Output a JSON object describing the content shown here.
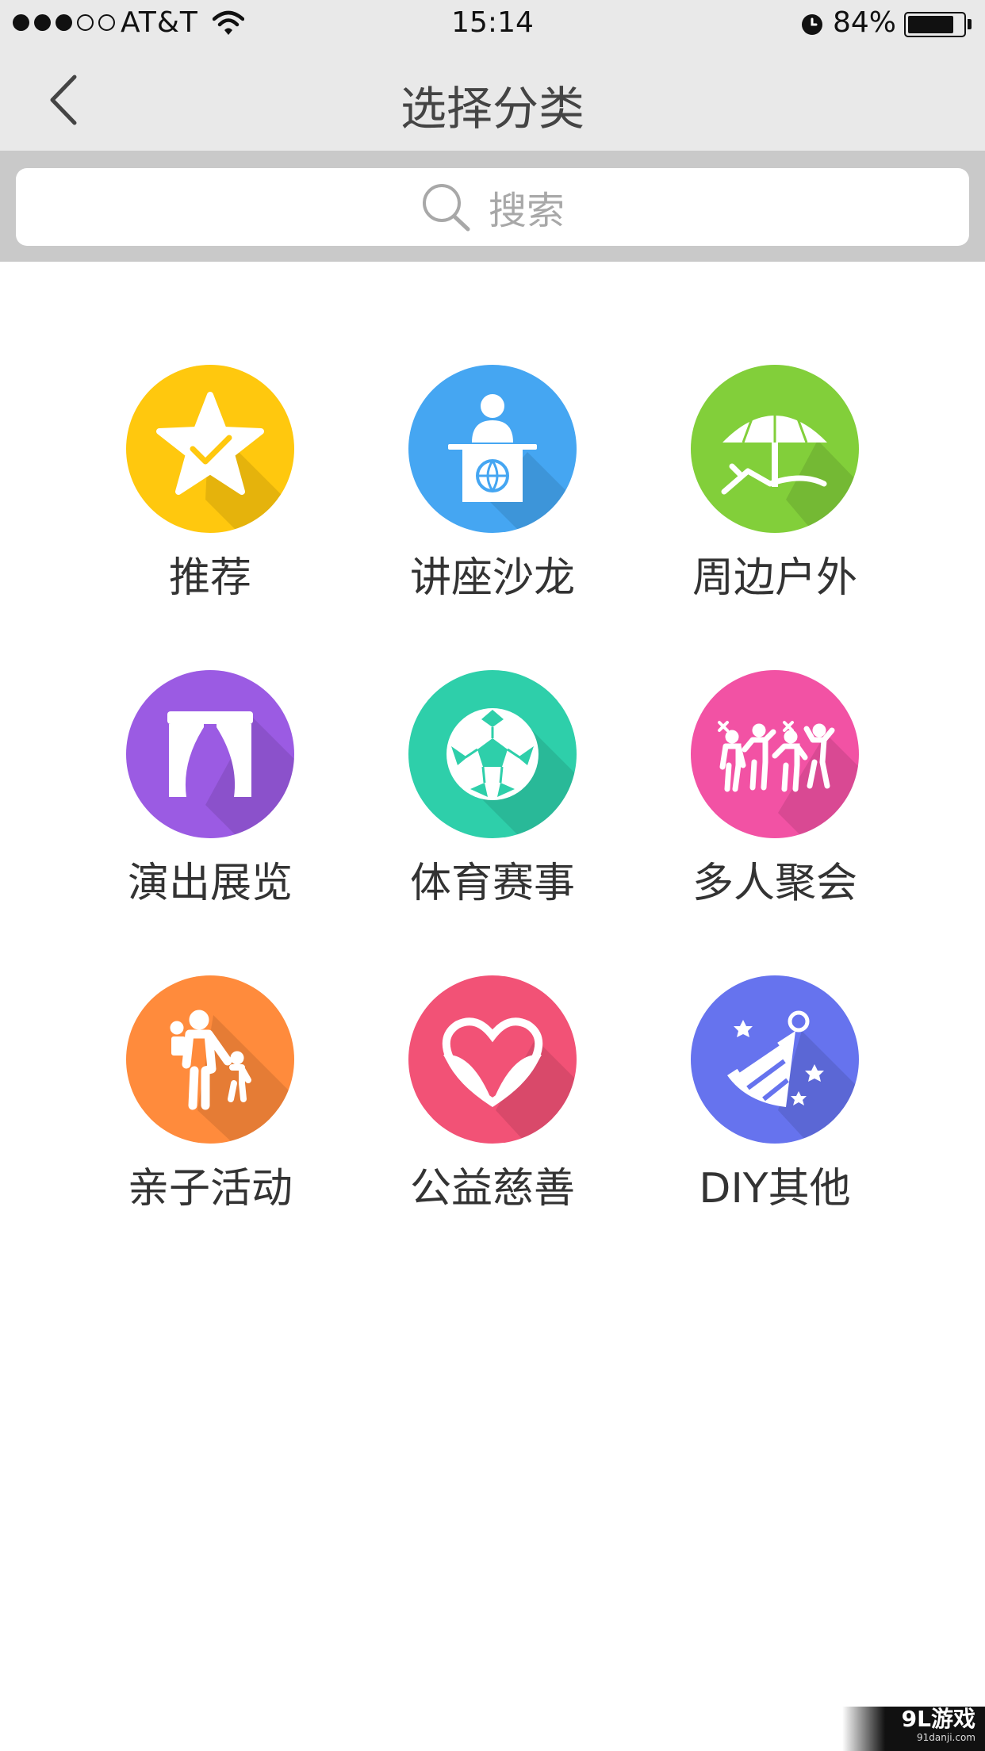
{
  "status_bar": {
    "carrier": "AT&T",
    "time": "15:14",
    "battery_pct": "84%",
    "signal_bars_filled": 3,
    "signal_bars_total": 5,
    "battery_level": 0.84
  },
  "nav": {
    "title": "选择分类"
  },
  "search": {
    "placeholder": "搜索"
  },
  "categories": [
    {
      "label": "推荐",
      "color": "#FFC80E",
      "icon": "star-check-icon"
    },
    {
      "label": "讲座沙龙",
      "color": "#45A6F2",
      "icon": "lecture-podium-icon"
    },
    {
      "label": "周边户外",
      "color": "#82CF3A",
      "icon": "beach-umbrella-icon"
    },
    {
      "label": "演出展览",
      "color": "#9B5BE3",
      "icon": "stage-curtain-icon"
    },
    {
      "label": "体育赛事",
      "color": "#2ECFAA",
      "icon": "soccer-ball-icon"
    },
    {
      "label": "多人聚会",
      "color": "#F252A4",
      "icon": "party-people-icon"
    },
    {
      "label": "亲子活动",
      "color": "#FF8B3C",
      "icon": "parent-child-icon"
    },
    {
      "label": "公益慈善",
      "color": "#F25276",
      "icon": "charity-heart-icon"
    },
    {
      "label": "DIY其他",
      "color": "#6673EE",
      "icon": "party-hat-icon"
    }
  ],
  "watermark": {
    "main": "9L游戏",
    "sub": "91danji.com"
  }
}
